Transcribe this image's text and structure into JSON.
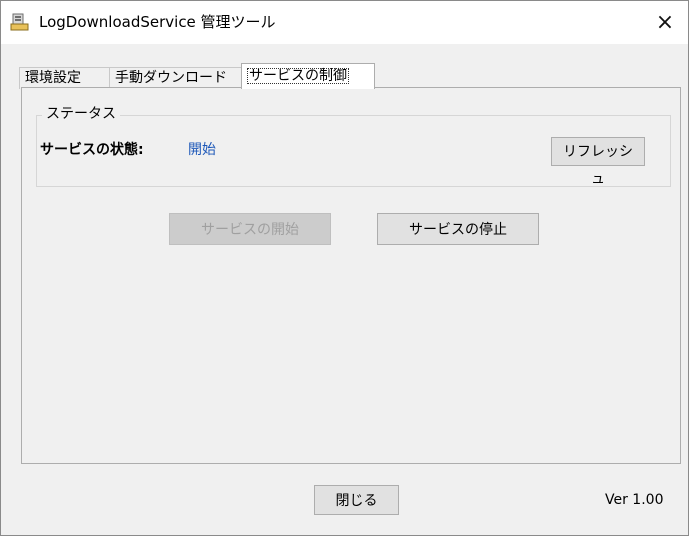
{
  "window": {
    "title": "LogDownloadService 管理ツール",
    "close_symbol": "×",
    "app_icon": "app-icon"
  },
  "tabs": [
    {
      "label": "環境設定",
      "selected": false
    },
    {
      "label": "手動ダウンロード",
      "selected": false
    },
    {
      "label": "サービスの制御",
      "selected": true
    }
  ],
  "status_group": {
    "title": "ステータス",
    "state_label": "サービスの状態:",
    "state_value": "開始",
    "refresh_label": "リフレッシュ"
  },
  "service_buttons": {
    "start_label": "サービスの開始",
    "start_enabled": false,
    "stop_label": "サービスの停止",
    "stop_enabled": true
  },
  "footer": {
    "close_label": "閉じる",
    "version": "Ver 1.00"
  },
  "colors": {
    "status_value": "#1c57b8",
    "disabled_text": "#a0a0a0"
  }
}
